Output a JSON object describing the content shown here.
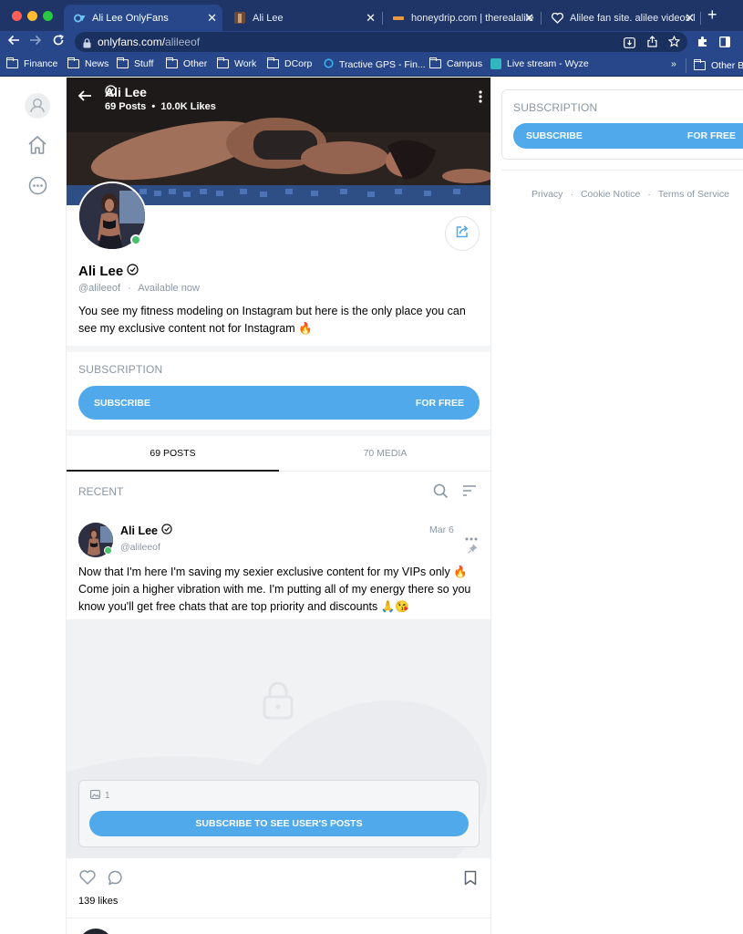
{
  "browser": {
    "tabs": [
      {
        "title": "Ali Lee OnlyFans",
        "active": true
      },
      {
        "title": "Ali Lee",
        "active": false
      },
      {
        "title": "honeydrip.com | therealalilee",
        "active": false
      },
      {
        "title": "Alilee fan site. alilee videos l",
        "active": false
      }
    ],
    "url_host": "onlyfans.com/",
    "url_path": "alileeof",
    "bookmarks": [
      "Finance",
      "News",
      "Stuff",
      "Other",
      "Work",
      "DCorp",
      "Tractive GPS - Fin...",
      "Campus",
      "Live stream - Wyze",
      "»",
      "Other Bo"
    ]
  },
  "profile": {
    "name": "Ali Lee",
    "stats": "69 Posts  •  10.0K Likes",
    "handle": "@alileeof",
    "availability": "Available now",
    "bio": "You see my fitness modeling on Instagram but here is the only place you can see my exclusive content not for Instagram 🔥"
  },
  "subscription": {
    "title": "SUBSCRIPTION",
    "button_left": "SUBSCRIBE",
    "button_right": "FOR FREE"
  },
  "tabs": {
    "posts": "69 POSTS",
    "media": "70 MEDIA"
  },
  "feed": {
    "recent_label": "RECENT"
  },
  "post": {
    "author": "Ali Lee",
    "handle": "@alileeof",
    "date": "Mar 6",
    "text": "Now that I'm here I'm saving my sexier exclusive content for my VIPs only 🔥 Come join a higher vibration with me. I'm putting all of my energy there so you know you'll get free chats that are top priority and discounts 🙏😘",
    "media_count": "1",
    "locked_button": "SUBSCRIBE TO SEE USER'S POSTS",
    "likes": "139 likes"
  },
  "right": {
    "subscription_title": "SUBSCRIPTION",
    "button_left": "SUBSCRIBE",
    "button_right": "FOR FREE",
    "footer": [
      "Privacy",
      "Cookie Notice",
      "Terms of Service"
    ]
  },
  "colors": {
    "accent": "#4fa9ea",
    "browser_chrome": "#27478a",
    "online": "#4ac16f",
    "muted_text": "#8a96a3"
  }
}
